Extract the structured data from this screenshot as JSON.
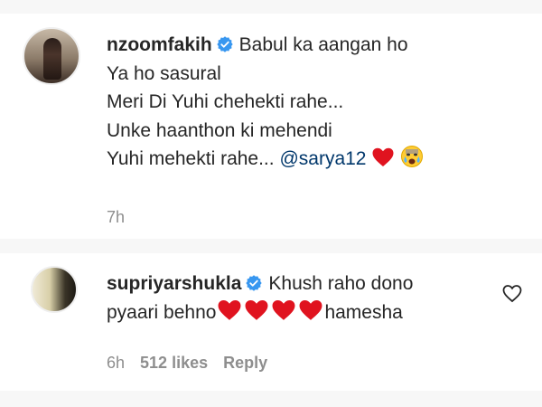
{
  "comments": [
    {
      "username": "nzoomfakih",
      "verified": true,
      "lines": [
        "Babul ka aangan ho",
        "Ya ho sasural",
        "Meri Di Yuhi chehekti rahe...",
        "Unke haanthon ki mehendi",
        "Yuhi mehekti rahe..."
      ],
      "mention": "@sarya12",
      "trailing_emojis": [
        "heart-icon",
        "crying-face-icon"
      ],
      "time": "7h"
    },
    {
      "username": "supriyarshukla",
      "verified": true,
      "line1": "Khush raho dono",
      "line2_start": "pyaari behno",
      "emoji_hearts": 4,
      "line2_end": "hamesha",
      "time": "6h",
      "likes": "512 likes",
      "reply": "Reply"
    }
  ],
  "icons": {
    "verified_color": "#3897f0",
    "heart_color": "#e0131f",
    "like_outline_color": "#262626"
  }
}
